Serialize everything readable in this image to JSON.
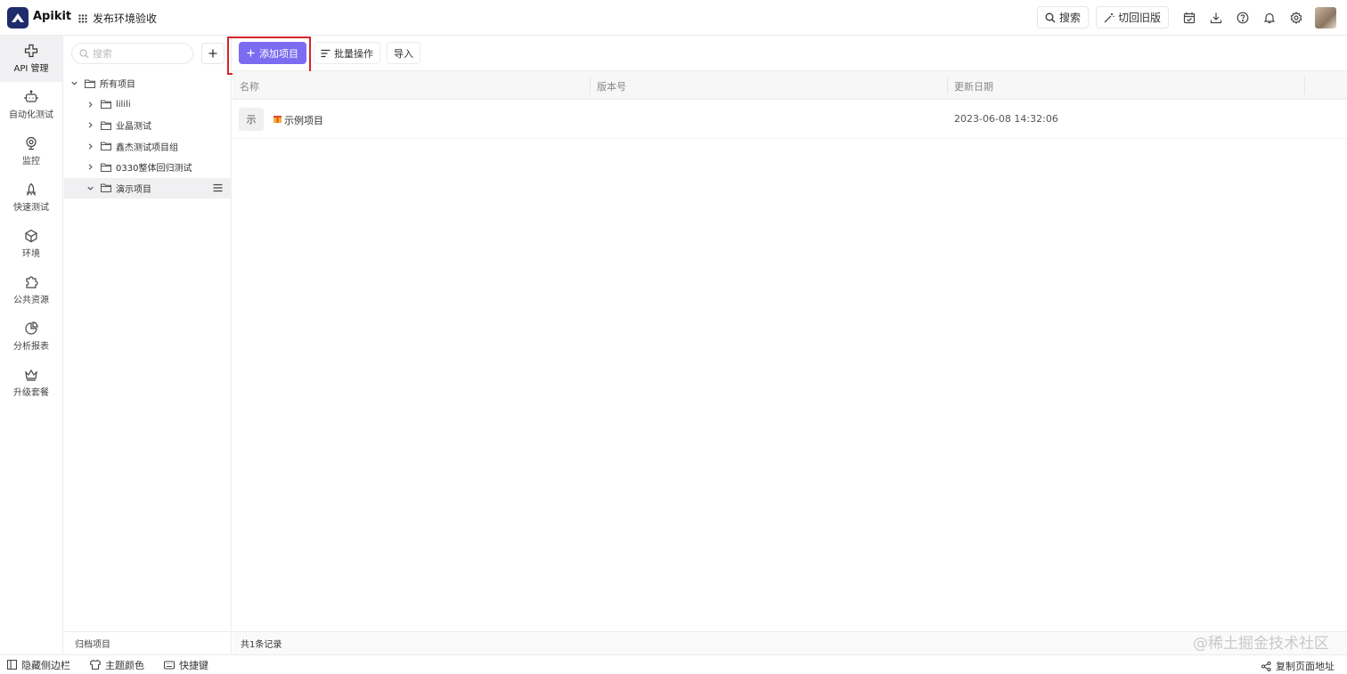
{
  "app": {
    "logo_text": "Apikit",
    "workspace": "发布环境验收"
  },
  "topbar": {
    "search_label": "搜索",
    "legacy_label": "切回旧版"
  },
  "nav": [
    {
      "label": "API 管理",
      "icon": "api-icon"
    },
    {
      "label": "自动化测试",
      "icon": "robot-icon"
    },
    {
      "label": "监控",
      "icon": "monitor-icon"
    },
    {
      "label": "快速测试",
      "icon": "rocket-icon"
    },
    {
      "label": "环境",
      "icon": "cube-icon"
    },
    {
      "label": "公共资源",
      "icon": "puzzle-icon"
    },
    {
      "label": "分析报表",
      "icon": "pie-chart-icon"
    },
    {
      "label": "升级套餐",
      "icon": "crown-icon"
    }
  ],
  "tree": {
    "search_placeholder": "搜索",
    "root": "所有项目",
    "groups": [
      "lilili",
      "业晶测试",
      "鑫杰测试项目组",
      "0330整体回归测试",
      "演示项目"
    ],
    "archive_label": "归档项目"
  },
  "toolbar": {
    "add_label": "添加项目",
    "batch_label": "批量操作",
    "import_label": "导入"
  },
  "table": {
    "columns": [
      "名称",
      "版本号",
      "更新日期"
    ],
    "rows": [
      {
        "badge": "示",
        "name": "示例项目",
        "version": "",
        "updated": "2023-06-08 14:32:06"
      }
    ],
    "total_label": "共1条记录"
  },
  "watermark": "@稀土掘金技术社区",
  "bottom": {
    "hide_sidebar": "隐藏侧边栏",
    "theme": "主题颜色",
    "shortcuts": "快捷键",
    "copy_url": "复制页面地址"
  }
}
